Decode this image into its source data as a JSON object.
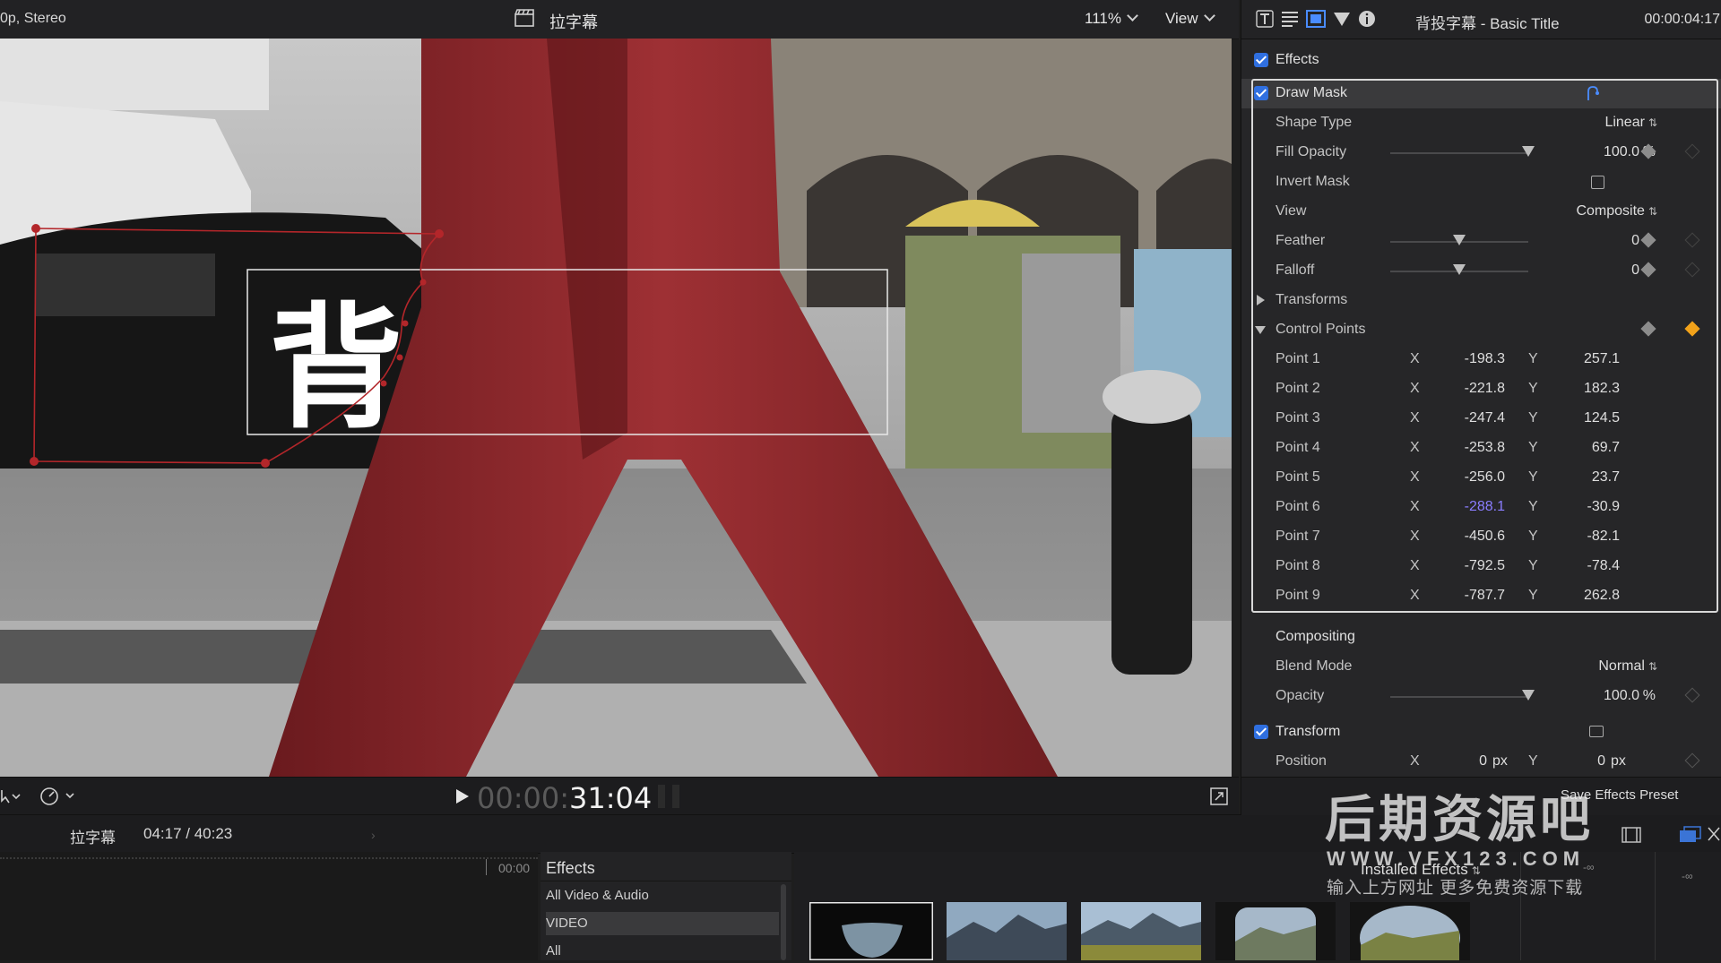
{
  "viewer": {
    "format": "0p, Stereo",
    "clip_name": "拉字幕",
    "zoom": "111%",
    "view_menu": "View",
    "overlay_glyph": "背"
  },
  "playback": {
    "timecode_dim": "00:00:",
    "timecode_bright": "31:04"
  },
  "timeline": {
    "project_name": "拉字幕",
    "duration": "04:17 / 40:23",
    "ruler_start": "00:00"
  },
  "effects_browser": {
    "title": "Effects",
    "items": [
      "All Video & Audio",
      "VIDEO",
      "All"
    ],
    "selected_item": "VIDEO",
    "installed_label": "Installed Effects",
    "infinity_1": "-∞",
    "infinity_2": "-∞"
  },
  "inspector": {
    "title": "背投字幕 - Basic Title",
    "timecode": "00:00:04:17",
    "effects_label": "Effects",
    "draw_mask_label": "Draw Mask",
    "shape_type_label": "Shape Type",
    "shape_type_value": "Linear",
    "fill_opacity_label": "Fill Opacity",
    "fill_opacity_value": "100.0",
    "fill_opacity_unit": "%",
    "fill_opacity_level": 1.0,
    "invert_mask_label": "Invert Mask",
    "view_label": "View",
    "view_value": "Composite",
    "feather_label": "Feather",
    "feather_value": "0",
    "feather_level": 0.5,
    "falloff_label": "Falloff",
    "falloff_value": "0",
    "falloff_level": 0.5,
    "transforms_label": "Transforms",
    "control_points_label": "Control Points",
    "x_label": "X",
    "y_label": "Y",
    "points": [
      {
        "label": "Point 1",
        "x": "-198.3",
        "y": "257.1"
      },
      {
        "label": "Point 2",
        "x": "-221.8",
        "y": "182.3"
      },
      {
        "label": "Point 3",
        "x": "-247.4",
        "y": "124.5"
      },
      {
        "label": "Point 4",
        "x": "-253.8",
        "y": "69.7"
      },
      {
        "label": "Point 5",
        "x": "-256.0",
        "y": "23.7"
      },
      {
        "label": "Point 6",
        "x": "-288.1",
        "y": "-30.9"
      },
      {
        "label": "Point 7",
        "x": "-450.6",
        "y": "-82.1"
      },
      {
        "label": "Point 8",
        "x": "-792.5",
        "y": "-78.4"
      },
      {
        "label": "Point 9",
        "x": "-787.7",
        "y": "262.8"
      }
    ],
    "compositing_label": "Compositing",
    "blend_mode_label": "Blend Mode",
    "blend_mode_value": "Normal",
    "opacity_label": "Opacity",
    "opacity_value": "100.0",
    "opacity_unit": "%",
    "opacity_level": 1.0,
    "transform_label": "Transform",
    "position_label": "Position",
    "position_x": "0",
    "position_y": "0",
    "position_unit": "px",
    "save_preset_label": "Save Effects Preset"
  },
  "watermark": {
    "title": "后期资源吧",
    "url": "WWW.VFX123.COM",
    "subtitle": "输入上方网址 更多免费资源下载"
  },
  "colors": {
    "accent": "#2f6fe0",
    "keyframe": "#f2a21a",
    "mask_line": "#b3262a",
    "field_highlight": "#8a7dff"
  },
  "icons": [
    "clapper-icon",
    "title-inspector-icon",
    "text-inspector-icon",
    "video-inspector-icon",
    "color-inspector-icon",
    "info-icon",
    "play-icon",
    "fullscreen-icon",
    "speed-icon",
    "keyframe-icon",
    "reset-icon"
  ]
}
